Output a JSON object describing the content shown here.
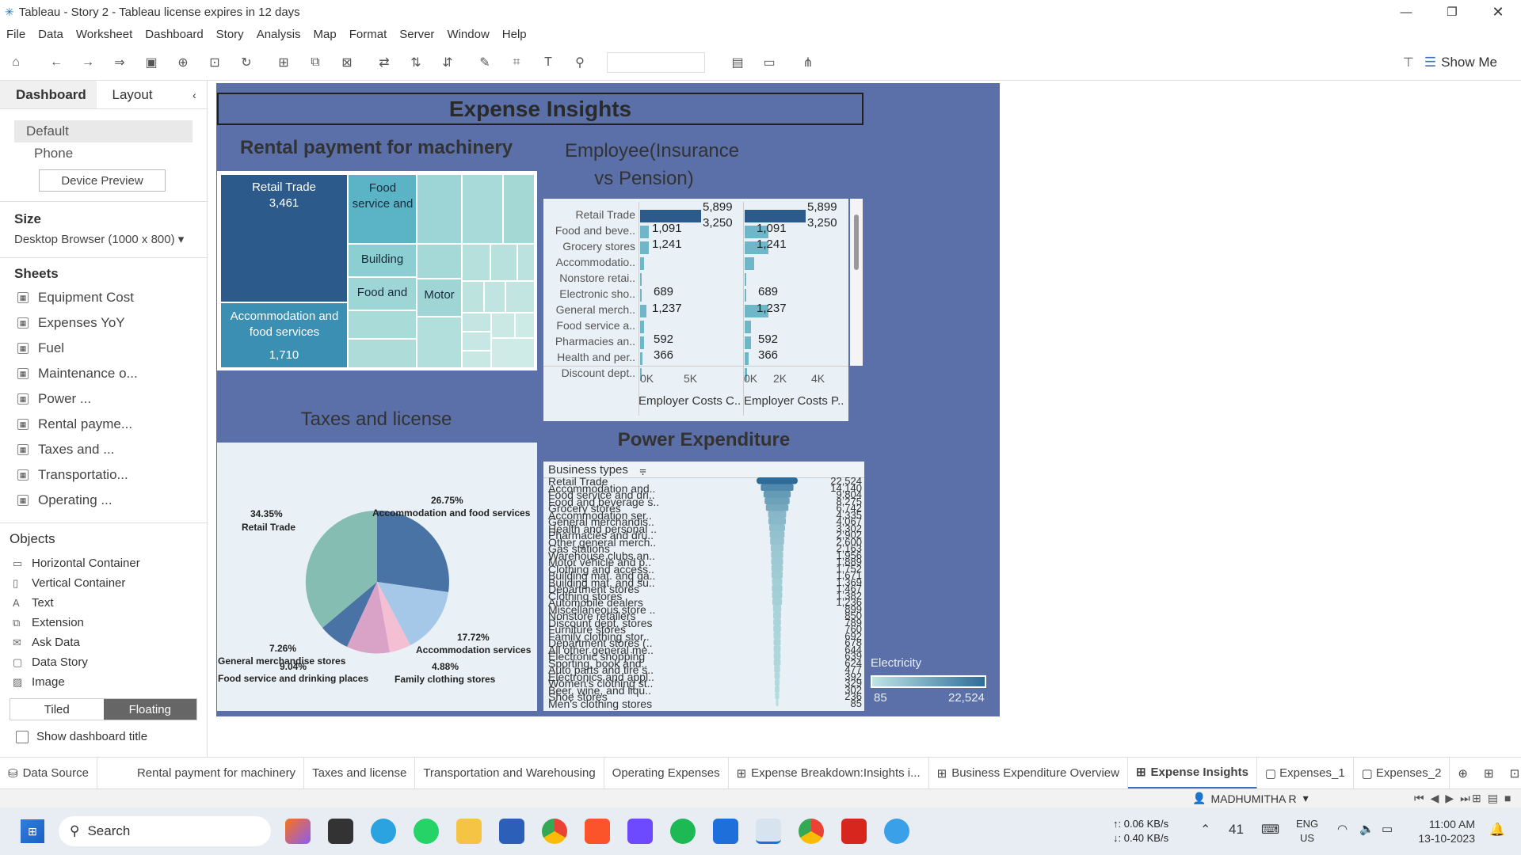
{
  "window": {
    "title": "Tableau - Story 2 - Tableau license expires in 12 days"
  },
  "menu": [
    "File",
    "Data",
    "Worksheet",
    "Dashboard",
    "Story",
    "Analysis",
    "Map",
    "Format",
    "Server",
    "Window",
    "Help"
  ],
  "toolbar": {
    "show_me": "Show Me"
  },
  "left": {
    "tab_dashboard": "Dashboard",
    "tab_layout": "Layout",
    "device_default": "Default",
    "device_phone": "Phone",
    "device_preview": "Device Preview",
    "size_label": "Size",
    "size_value": "Desktop Browser (1000 x 800)",
    "sheets_label": "Sheets",
    "sheets": [
      "Equipment Cost",
      "Expenses YoY",
      "Fuel",
      "Maintenance o...",
      "Power ...",
      "Rental payme...",
      "Taxes and ...",
      "Transportatio...",
      "Operating ..."
    ],
    "objects_label": "Objects",
    "objects": [
      "Horizontal Container",
      "Vertical Container",
      "Text",
      "Extension",
      "Ask Data",
      "Data Story",
      "Image"
    ],
    "tiled": "Tiled",
    "floating": "Floating",
    "show_title": "Show dashboard title"
  },
  "dashboard": {
    "title": "Expense Insights",
    "rental_title": "Rental payment for machinery",
    "treemap": {
      "retail": "Retail Trade",
      "retail_val": "3,461",
      "accom": "Accommodation and food services",
      "accom_val": "1,710",
      "food": "Food service and",
      "building": "Building",
      "foodand": "Food and",
      "motor": "Motor"
    },
    "emp_title": "Employee(Insurance vs Pension)",
    "emp_categories": [
      "Retail Trade",
      "Food and beve..",
      "Grocery stores",
      "Accommodatio..",
      "Nonstore retai..",
      "Electronic sho..",
      "General merch..",
      "Food service a..",
      "Pharmacies an..",
      "Health and per..",
      "Discount dept.."
    ],
    "emp_values_a": [
      "5,899",
      "1,091",
      "1,241",
      "",
      "",
      "",
      "689",
      "",
      "592",
      "",
      ""
    ],
    "emp_values_b": [
      "3,250",
      "",
      "",
      "",
      "",
      "",
      "1,237",
      "",
      "366",
      "",
      ""
    ],
    "emp_axis_a": [
      "0K",
      "5K"
    ],
    "emp_axis_b": [
      "0K",
      "2K",
      "4K"
    ],
    "emp_col_a": "Employer Costs C..",
    "emp_col_b": "Employer Costs P..",
    "taxes_title": "Taxes and license",
    "pie_labels": [
      {
        "pct": "26.75%",
        "name": "Accommodation and food services"
      },
      {
        "pct": "34.35%",
        "name": "Retail Trade"
      },
      {
        "pct": "17.72%",
        "name": "Accommodation services"
      },
      {
        "pct": "4.88%",
        "name": "Family clothing stores"
      },
      {
        "pct": "9.04%",
        "name": "Food service and drinking places"
      },
      {
        "pct": "7.26%",
        "name": "General merchandise stores"
      }
    ],
    "power_title": "Power Expenditure",
    "power_header": "Business types",
    "power_rows": [
      "Retail Trade",
      "Accommodation and..",
      "Food service and dri..",
      "Food and beverage s..",
      "Grocery stores",
      "Accommodation ser..",
      "General merchandis..",
      "Health and personal ..",
      "Pharmacies and dru..",
      "Other general merch..",
      "Gas stations",
      "Warehouse clubs an..",
      "Motor vehicle and p..",
      "Clothing and access..",
      "Building mat. and ga..",
      "Building mat. and su..",
      "Department stores",
      "Clothing stores",
      "Automobile dealers",
      "Miscellaneous store ..",
      "Nonstore retailers",
      "Discount dept. stores",
      "Furniture stores",
      "Family clothing stor..",
      "Department stores (..",
      "All other general me..",
      "Electronic shopping",
      "Sporting, book and..",
      "Auto parts and tire s..",
      "Electronics and appl..",
      "Women's clothing st..",
      "Beer, wine, and liqu..",
      "Shoe stores",
      "Men's clothing stores"
    ],
    "power_vals": [
      "22,524",
      "14,140",
      "9,804",
      "8,275",
      "6,742",
      "4,335",
      "4,067",
      "3,302",
      "2,902",
      "2,600",
      "2,163",
      "1,956",
      "1,889",
      "1,752",
      "1,671",
      "1,369",
      "1,467",
      "1,382",
      "1,236",
      "899",
      "850",
      "789",
      "760",
      "692",
      "678",
      "644",
      "639",
      "624",
      "477",
      "392",
      "329",
      "302",
      "236",
      "85"
    ],
    "legend_title": "Electricity",
    "legend_min": "85",
    "legend_max": "22,524"
  },
  "tabs": [
    "Data Source",
    "Rental payment for machinery",
    "Taxes and license",
    "Transportation and Warehousing",
    "Operating Expenses",
    "Expense Breakdown:Insights i...",
    "Business Expenditure Overview",
    "Expense Insights",
    "Expenses_1",
    "Expenses_2"
  ],
  "status": {
    "user": "MADHUMITHA R"
  },
  "taskbar": {
    "search": "Search",
    "net_up": "↑: 0.06 KB/s",
    "net_down": "↓: 0.40 KB/s",
    "temp": "41",
    "lang1": "ENG",
    "lang2": "US",
    "time": "11:00 AM",
    "date": "13-10-2023"
  }
}
